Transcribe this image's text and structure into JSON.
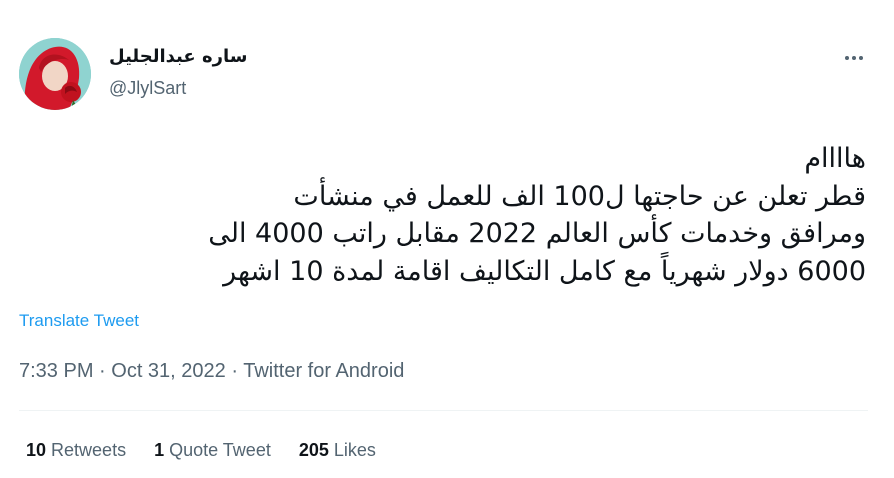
{
  "author": {
    "display_name": "ساره عبدالجليل",
    "handle": "@JlylSart"
  },
  "tweet": {
    "lines": [
      "هاااام",
      "قطر تعلن عن حاجتها ل100 الف للعمل في منشأت",
      "ومرافق وخدمات كأس العالم 2022 مقابل راتب 4000 الى",
      "6000 دولار شهرياً مع كامل التكاليف اقامة لمدة 10 اشهر"
    ],
    "translate_label": "Translate Tweet"
  },
  "meta": {
    "time": "7:33 PM",
    "separator": "·",
    "date": "Oct 31, 2022",
    "source": "Twitter for Android"
  },
  "stats": {
    "retweets_count": "10",
    "retweets_label": "Retweets",
    "quotes_count": "1",
    "quotes_label": "Quote Tweet",
    "likes_count": "205",
    "likes_label": "Likes"
  },
  "icons": {
    "more": "more-horizontal-icon"
  },
  "colors": {
    "link": "#1d9bf0",
    "secondary_text": "#536471",
    "primary_text": "#0f1419",
    "divider": "#eff3f4"
  }
}
